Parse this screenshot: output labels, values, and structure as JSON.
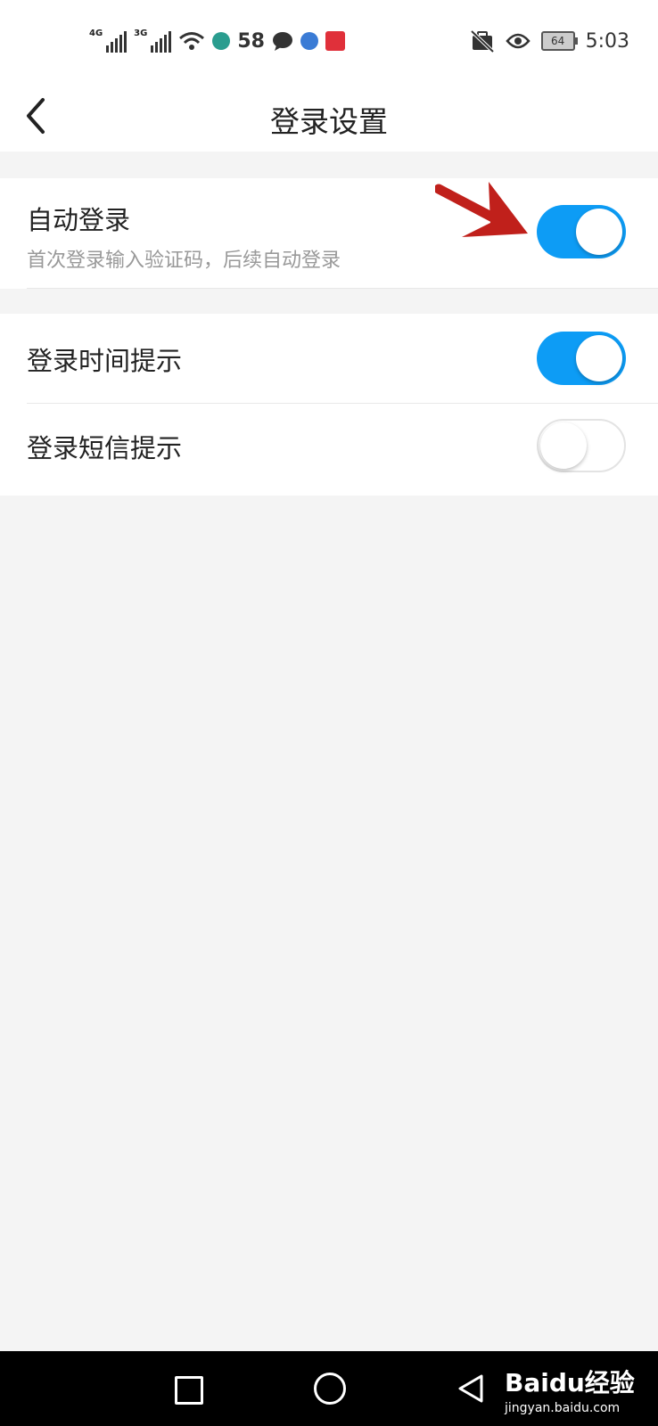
{
  "status_bar": {
    "signal1_type": "4G",
    "signal2_type": "3G",
    "notification_num": "58",
    "battery": "64",
    "time": "5:03"
  },
  "header": {
    "title": "登录设置"
  },
  "settings": {
    "auto_login": {
      "label": "自动登录",
      "description": "首次登录输入验证码，后续自动登录",
      "enabled": true
    },
    "login_time_tip": {
      "label": "登录时间提示",
      "enabled": true
    },
    "login_sms_tip": {
      "label": "登录短信提示",
      "enabled": false
    }
  },
  "watermark": {
    "brand": "Baidu经验",
    "url": "jingyan.baidu.com"
  },
  "colors": {
    "toggle_on": "#0d9cf5",
    "annotation_arrow": "#c0201b"
  }
}
